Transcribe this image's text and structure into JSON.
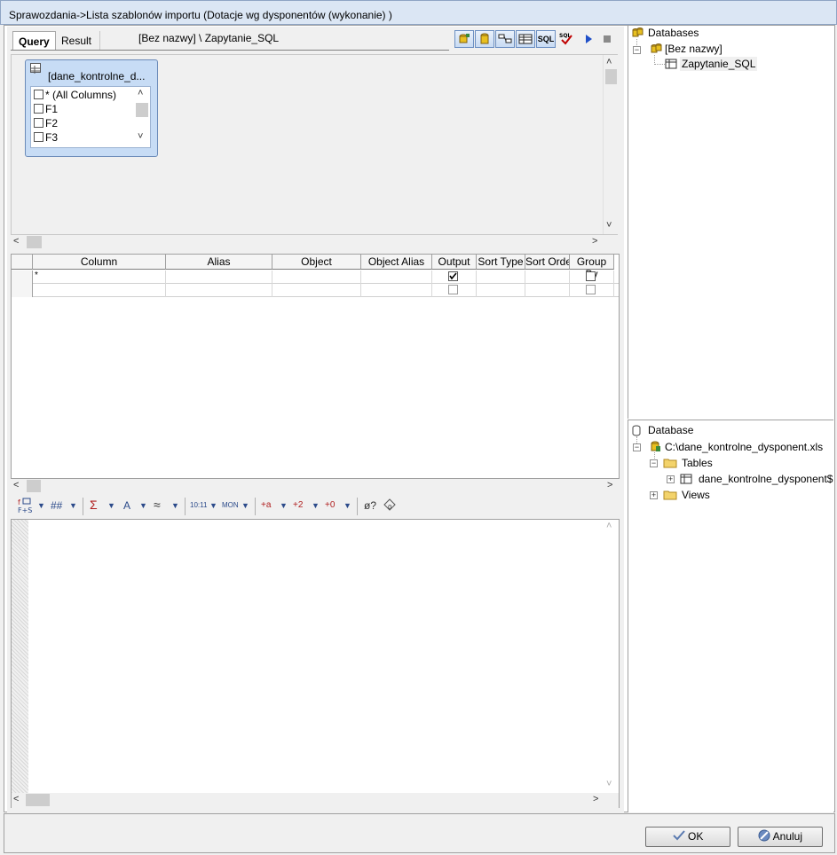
{
  "window": {
    "title": "Sprawozdania->Lista szablonów importu (Dotacje wg dysponentów (wykonanie) )"
  },
  "tabs": {
    "query": "Query",
    "result": "Result"
  },
  "query_path": "[Bez nazwy] \\ Zapytanie_SQL",
  "toolbar": {
    "icons": [
      "database-add-icon",
      "database-icon",
      "diagram-icon",
      "grid-icon",
      "sql-icon",
      "sql-check-icon",
      "run-icon",
      "stop-icon"
    ],
    "sql_label": "SQL"
  },
  "table_box": {
    "title": "[dane_kontrolne_d...",
    "columns": [
      "* (All Columns)",
      "F1",
      "F2",
      "F3"
    ]
  },
  "grid": {
    "headers": [
      "Column",
      "Alias",
      "Object",
      "Object Alias",
      "Output",
      "Sort Type",
      "Sort Order",
      "Group By"
    ],
    "rows": [
      {
        "column": "*",
        "output": true,
        "group_by": false
      },
      {
        "column": "",
        "output": false,
        "group_by": false
      }
    ]
  },
  "format_toolbar": {
    "items": [
      "##",
      "Σ",
      "A",
      "≈",
      "10:11",
      "MON",
      "+a",
      "+2",
      "+0",
      "ø?"
    ]
  },
  "db_tree": {
    "root": "Databases",
    "child": "[Bez nazwy]",
    "leaf": "Zapytanie_SQL"
  },
  "schema_tree": {
    "root": "Database",
    "file": "C:\\dane_kontrolne_dysponent.xls",
    "tables": "Tables",
    "table": "dane_kontrolne_dysponent$",
    "views": "Views"
  },
  "buttons": {
    "ok": "OK",
    "cancel": "Anuluj"
  }
}
